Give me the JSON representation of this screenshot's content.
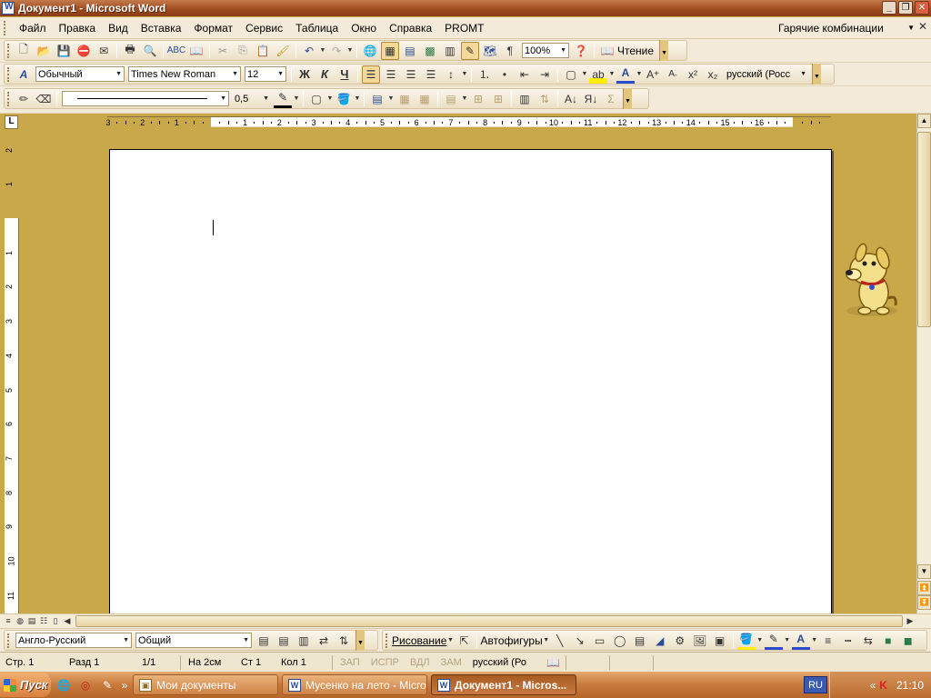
{
  "window": {
    "title": "Документ1 - Microsoft Word"
  },
  "menu": {
    "items": [
      "Файл",
      "Правка",
      "Вид",
      "Вставка",
      "Формат",
      "Сервис",
      "Таблица",
      "Окно",
      "Справка",
      "PROMT"
    ],
    "hotkeys_label": "Гарячие комбинации"
  },
  "standard_toolbar": {
    "zoom": "100%",
    "reading_label": "Чтение"
  },
  "formatting_toolbar": {
    "style": "Обычный",
    "font": "Times New Roman",
    "size": "12",
    "bold": "Ж",
    "italic": "К",
    "underline": "Ч",
    "language": "русский (Росс"
  },
  "tables_toolbar": {
    "line_weight": "0,5"
  },
  "ruler": {
    "h_numbers": [
      "3",
      "2",
      "1",
      "1",
      "2",
      "3",
      "4",
      "5",
      "6",
      "7",
      "8",
      "9",
      "10",
      "11",
      "12",
      "13",
      "14",
      "15",
      "16"
    ],
    "v_numbers": [
      "2",
      "1",
      "1",
      "2",
      "3",
      "4",
      "5",
      "6",
      "7",
      "8",
      "9",
      "10",
      "11"
    ],
    "tab_selector": "L"
  },
  "bottom_toolbar": {
    "translate_direction": "Англо-Русский",
    "topic": "Общий",
    "drawing_label": "Рисование",
    "autoshapes_label": "Автофигуры"
  },
  "status": {
    "page": "Стр. 1",
    "section": "Разд 1",
    "pages": "1/1",
    "at": "На 2см",
    "line": "Ст 1",
    "col": "Кол 1",
    "rec": "ЗАП",
    "trk": "ИСПР",
    "ext": "ВДЛ",
    "ovr": "ЗАМ",
    "lang": "русский (Ро"
  },
  "taskbar": {
    "start_label": "Пуск",
    "tasks": [
      "Мои документы",
      "Мусенко на лето - Micro...",
      "Документ1 - Micros..."
    ],
    "lang": "RU",
    "clock": "21:10"
  },
  "colors": {
    "accent": "#c9a84a",
    "title": "#9c4a1e",
    "toolbar": "#f3ead9"
  }
}
